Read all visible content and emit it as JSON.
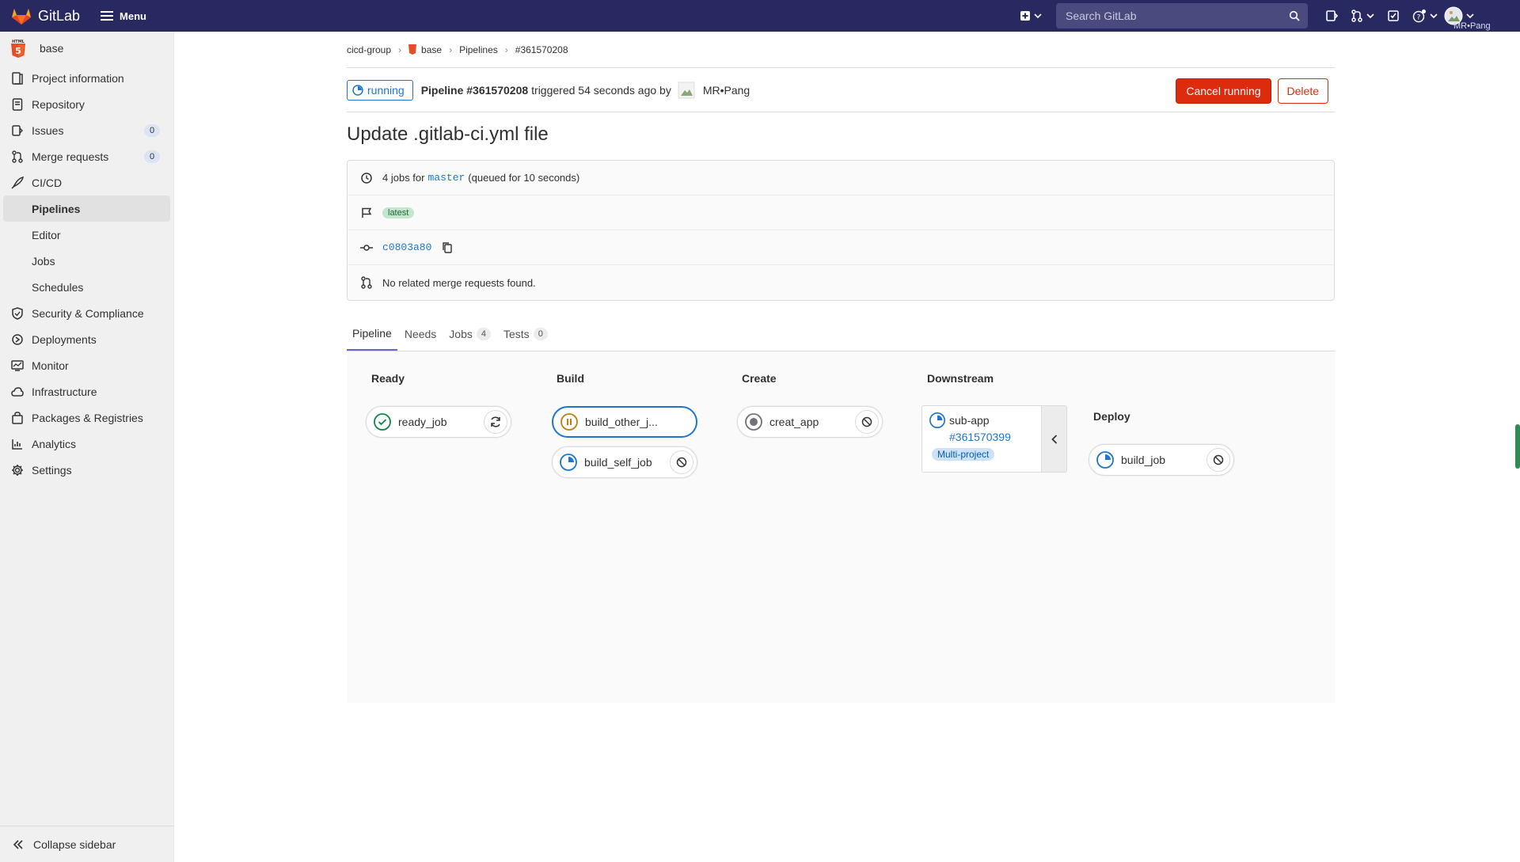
{
  "topbar": {
    "brand": "GitLab",
    "menu_label": "Menu",
    "search_placeholder": "Search GitLab",
    "user_label": "MR•Pang"
  },
  "sidebar": {
    "project_name": "base",
    "items": {
      "project_info": "Project information",
      "repository": "Repository",
      "issues": "Issues",
      "issues_count": "0",
      "merge_requests": "Merge requests",
      "merge_requests_count": "0",
      "cicd": "CI/CD",
      "pipelines": "Pipelines",
      "editor": "Editor",
      "jobs": "Jobs",
      "schedules": "Schedules",
      "security": "Security & Compliance",
      "deployments": "Deployments",
      "monitor": "Monitor",
      "infrastructure": "Infrastructure",
      "packages": "Packages & Registries",
      "analytics": "Analytics",
      "settings": "Settings"
    },
    "collapse_label": "Collapse sidebar"
  },
  "breadcrumb": {
    "group": "cicd-group",
    "project": "base",
    "section": "Pipelines",
    "current": "#361570208"
  },
  "pipeline": {
    "status": "running",
    "title": "Pipeline #361570208",
    "triggered_text": "triggered 54 seconds ago by",
    "user": "MR•Pang",
    "cancel_label": "Cancel running",
    "delete_label": "Delete",
    "commit_title": "Update .gitlab-ci.yml file",
    "jobs_prefix": "4 jobs for",
    "branch": "master",
    "queued_text": "(queued for 10 seconds)",
    "latest_badge": "latest",
    "commit_sha": "c0803a80",
    "merge_requests_text": "No related merge requests found."
  },
  "tabs": [
    {
      "label": "Pipeline",
      "count": null
    },
    {
      "label": "Needs",
      "count": null
    },
    {
      "label": "Jobs",
      "count": "4"
    },
    {
      "label": "Tests",
      "count": "0"
    }
  ],
  "graph": {
    "stages": {
      "ready": "Ready",
      "build": "Build",
      "create": "Create",
      "downstream": "Downstream",
      "deploy": "Deploy"
    },
    "jobs": {
      "ready_job": "ready_job",
      "build_other": "build_other_j...",
      "build_self": "build_self_job",
      "creat_app": "creat_app",
      "build_job": "build_job"
    },
    "downstream": {
      "project": "sub-app",
      "pipeline": "#361570399",
      "badge": "Multi-project"
    }
  },
  "colors": {
    "navbar": "#292961",
    "link": "#1f75cb",
    "danger": "#dd2b0e",
    "success": "#108548",
    "warning": "#c17d10"
  }
}
